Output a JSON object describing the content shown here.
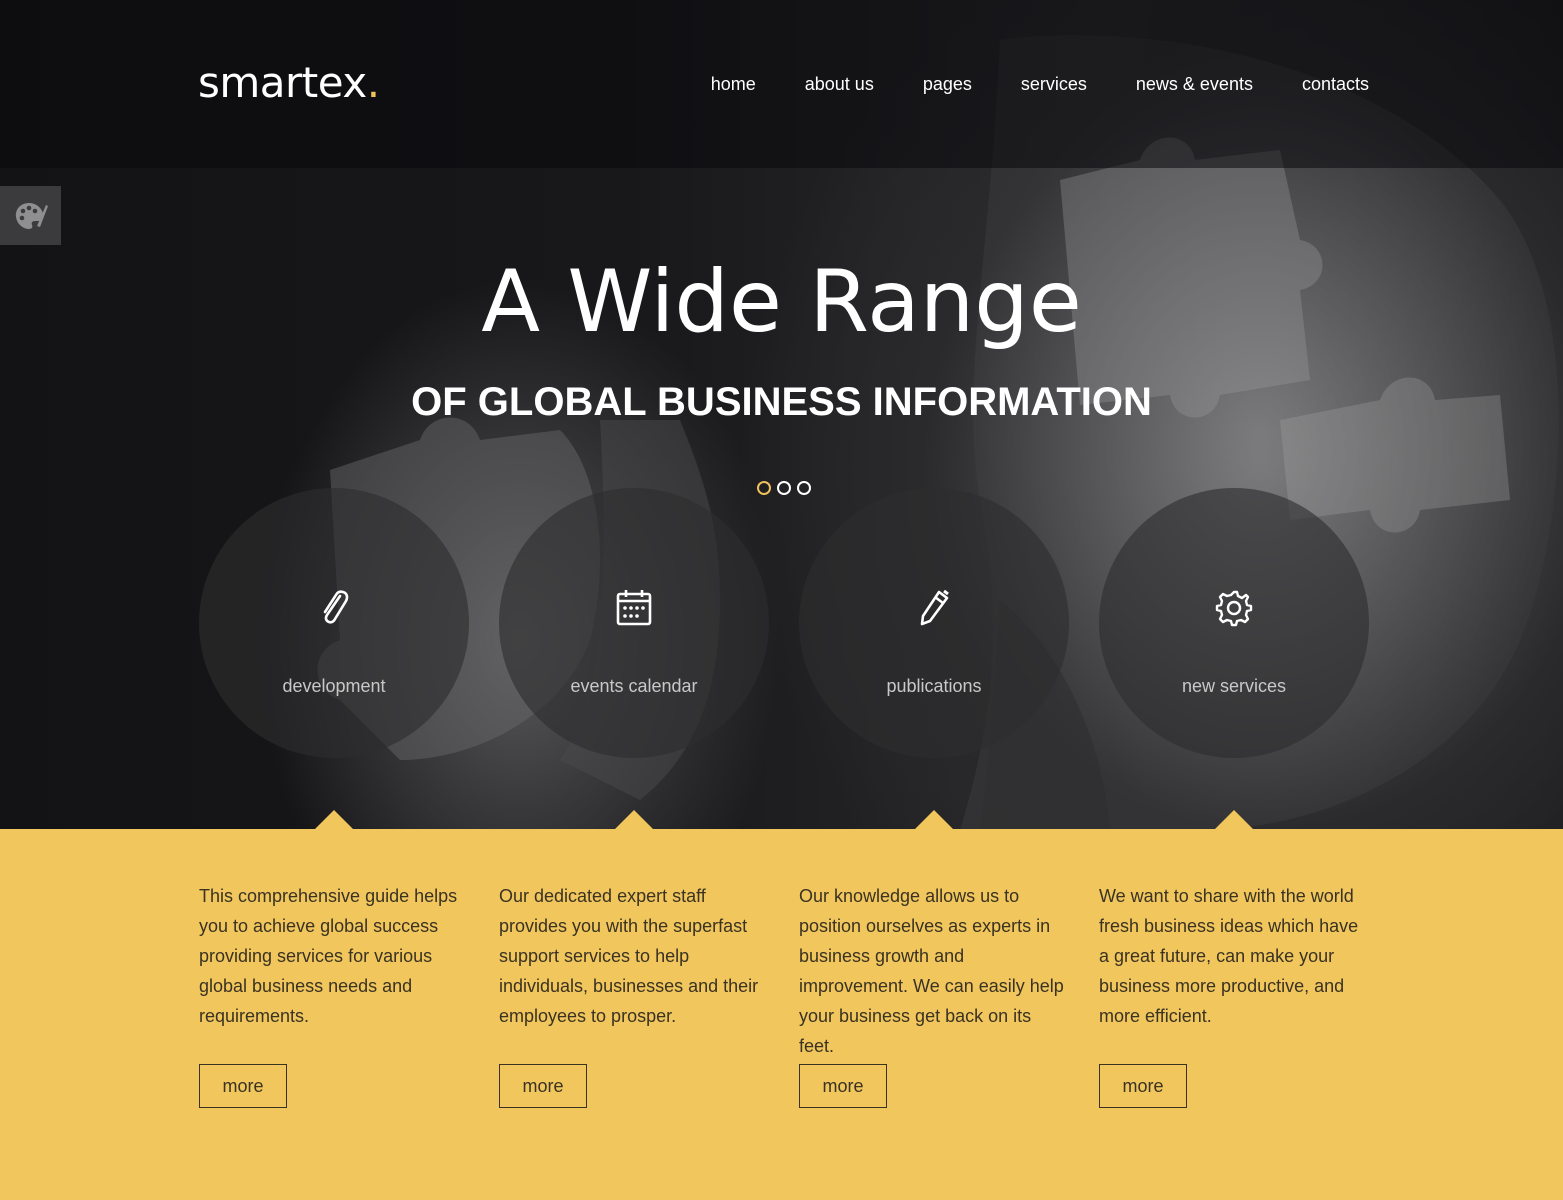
{
  "header": {
    "logo_text": "smartex",
    "logo_dot": ".",
    "nav": [
      "home",
      "about us",
      "pages",
      "services",
      "news & events",
      "contacts"
    ]
  },
  "side_tab": {
    "icon": "palette-icon"
  },
  "hero": {
    "title": "A Wide Range",
    "subtitle": "OF GLOBAL BUSINESS INFORMATION",
    "slider_dots": 3,
    "active_dot": 0
  },
  "services": [
    {
      "label": "development",
      "icon": "paperclip-icon",
      "description": "This comprehensive guide helps you to achieve global success providing services for various global business needs and requirements.",
      "button": "more"
    },
    {
      "label": "events calendar",
      "icon": "calendar-icon",
      "description": "Our dedicated expert staff provides you with the superfast support services to help individuals, businesses and their employees to prosper.",
      "button": "more"
    },
    {
      "label": "publications",
      "icon": "pencil-icon",
      "description": "Our knowledge allows us to position ourselves as experts in business growth and improvement. We can easily help your business get back on its feet.",
      "button": "more"
    },
    {
      "label": "new services",
      "icon": "gear-icon",
      "description": "We want to share with the world fresh business ideas which have a great future, can make your business more productive, and more efficient.",
      "button": "more"
    }
  ],
  "colors": {
    "accent": "#f0c15b",
    "band": "#f0c65d",
    "dark": "#151517"
  }
}
